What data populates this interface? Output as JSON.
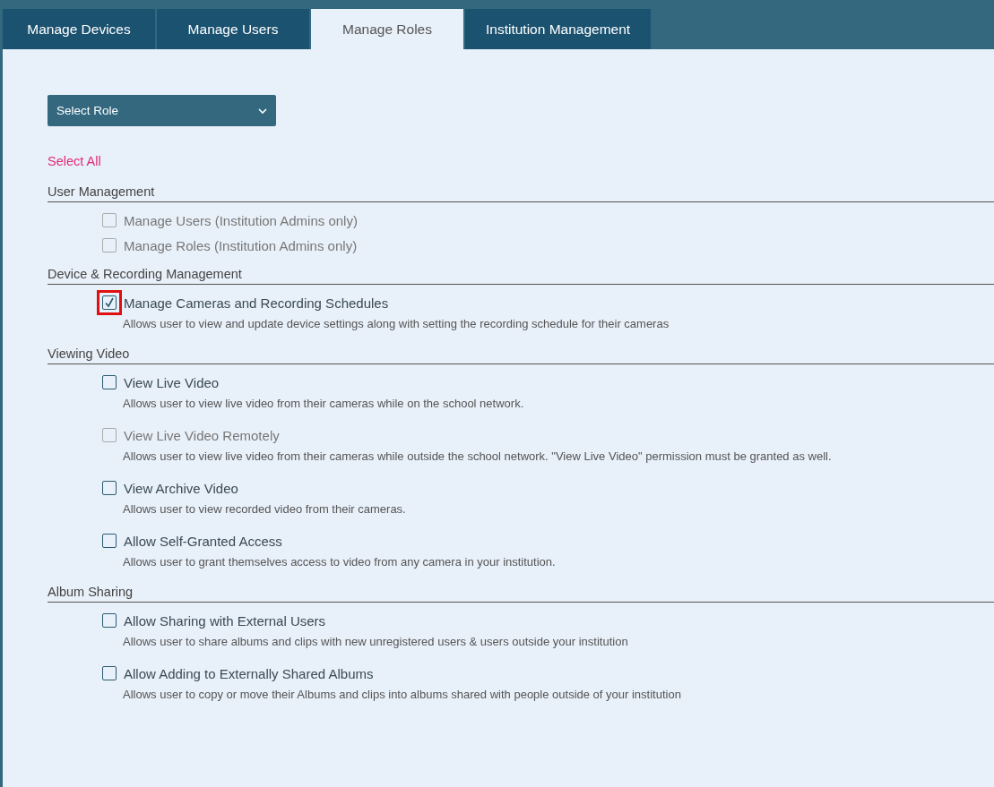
{
  "tabs": [
    {
      "label": "Manage Devices",
      "selected": false
    },
    {
      "label": "Manage Users",
      "selected": false
    },
    {
      "label": "Manage Roles",
      "selected": true
    },
    {
      "label": "Institution Management",
      "selected": false
    }
  ],
  "role_select": {
    "label": "Select Role"
  },
  "select_all": "Select All",
  "sections": [
    {
      "title": "User Management",
      "permissions": [
        {
          "label": "Manage Users (Institution Admins only)",
          "checked": false,
          "disabled": true,
          "highlighted": false
        },
        {
          "label": "Manage Roles (Institution Admins only)",
          "checked": false,
          "disabled": true,
          "highlighted": false
        }
      ]
    },
    {
      "title": "Device & Recording Management",
      "permissions": [
        {
          "label": "Manage Cameras and Recording Schedules",
          "description": "Allows user to view and update device settings along with setting the recording schedule for their cameras",
          "checked": true,
          "disabled": false,
          "highlighted": true
        }
      ]
    },
    {
      "title": "Viewing Video",
      "permissions": [
        {
          "label": "View Live Video",
          "description": "Allows user to view live video from their cameras while on the school network.",
          "checked": false,
          "disabled": false,
          "highlighted": false
        },
        {
          "label": "View Live Video Remotely",
          "description": "Allows user to view live video from their cameras while outside the school network. \"View Live Video\" permission must be granted as well.",
          "checked": false,
          "disabled": true,
          "highlighted": false
        },
        {
          "label": "View Archive Video",
          "description": "Allows user to view recorded video from their cameras.",
          "checked": false,
          "disabled": false,
          "highlighted": false
        },
        {
          "label": "Allow Self-Granted Access",
          "description": "Allows user to grant themselves access to video from any camera in your institution.",
          "checked": false,
          "disabled": false,
          "highlighted": false
        }
      ]
    },
    {
      "title": "Album Sharing",
      "permissions": [
        {
          "label": "Allow Sharing with External Users",
          "description": "Allows user to share albums and clips with new unregistered users & users outside your institution",
          "checked": false,
          "disabled": false,
          "highlighted": false
        },
        {
          "label": "Allow Adding to Externally Shared Albums",
          "description": "Allows user to copy or move their Albums and clips into albums shared with people outside of your institution",
          "checked": false,
          "disabled": false,
          "highlighted": false
        }
      ]
    }
  ]
}
